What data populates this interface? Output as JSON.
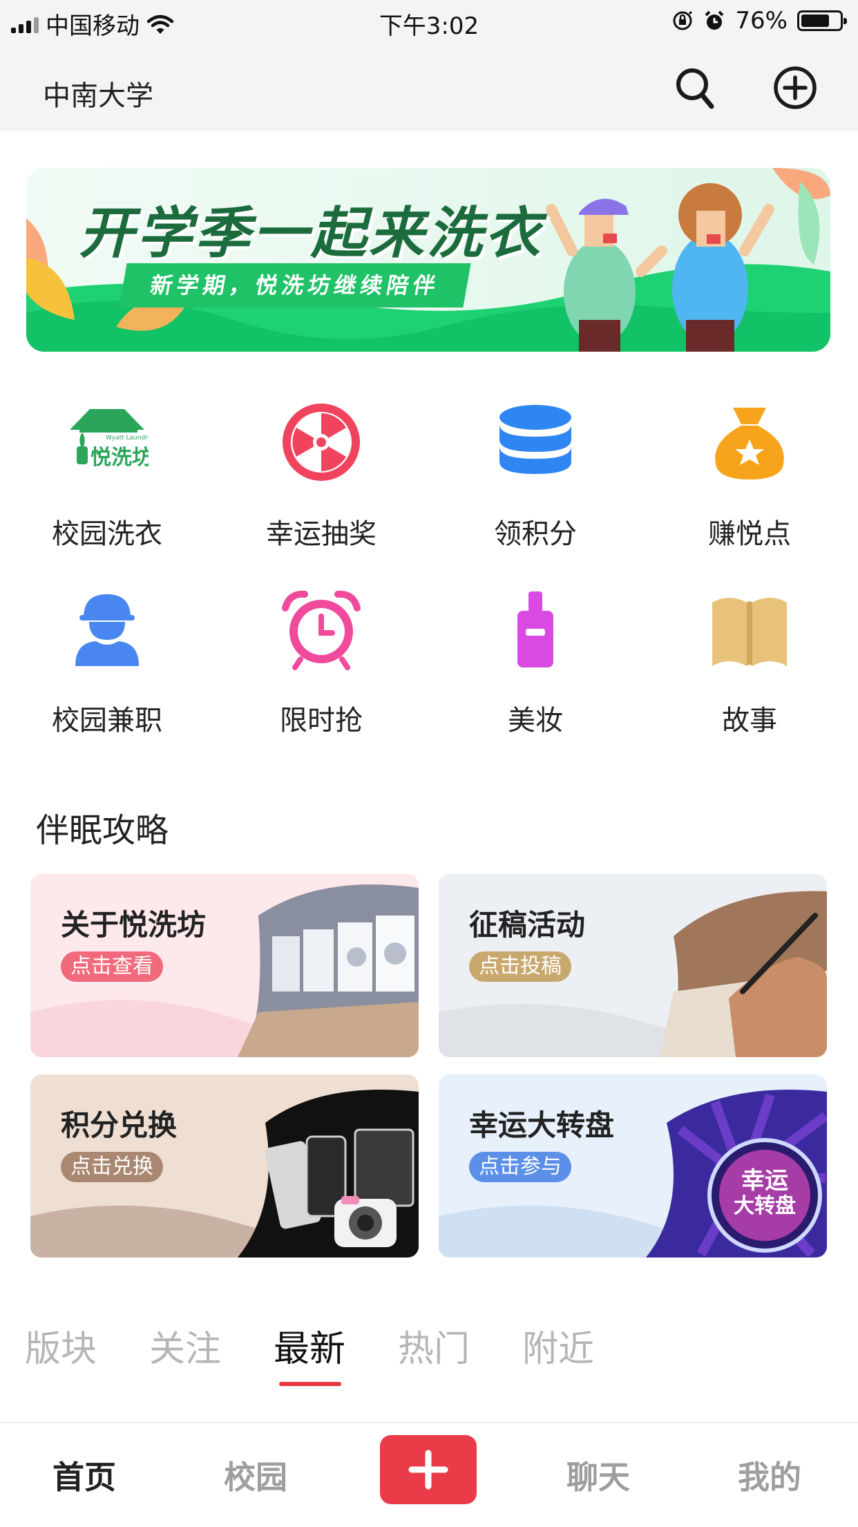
{
  "status_bar": {
    "carrier": "中国移动",
    "time": "下午3:02",
    "battery_percent": "76%",
    "battery_level": 0.76
  },
  "header": {
    "school_name": "中南大学",
    "search_icon": "search-icon",
    "add_icon": "add-circle-icon"
  },
  "banner": {
    "title": "开学季一起来洗衣",
    "subtitle": "新学期，悦洗坊继续陪伴",
    "logo_text": "悦洗坊",
    "logo_sub": "Wyatt Laundry"
  },
  "services": [
    {
      "label": "校园洗衣",
      "icon": "laundry-house-icon",
      "color": "#2aa55a"
    },
    {
      "label": "幸运抽奖",
      "icon": "lucky-wheel-icon",
      "color": "#f0445e"
    },
    {
      "label": "领积分",
      "icon": "coin-stack-icon",
      "color": "#2e86f0"
    },
    {
      "label": "赚悦点",
      "icon": "money-bag-icon",
      "color": "#f7a41c"
    },
    {
      "label": "校园兼职",
      "icon": "worker-icon",
      "color": "#4a86f0"
    },
    {
      "label": "限时抢",
      "icon": "alarm-clock-icon",
      "color": "#f04a9c"
    },
    {
      "label": "美妆",
      "icon": "cosmetic-bottle-icon",
      "color": "#d94ae0"
    },
    {
      "label": "故事",
      "icon": "book-icon",
      "color": "#e8c27a"
    }
  ],
  "guide": {
    "title": "伴眠攻略",
    "cards": [
      {
        "title": "关于悦洗坊",
        "button": "点击查看",
        "button_color": "#f06a7c",
        "bg": "#fde9ec"
      },
      {
        "title": "征稿活动",
        "button": "点击投稿",
        "button_color": "#c9a86e",
        "bg": "#eceff3"
      },
      {
        "title": "积分兑换",
        "button": "点击兑换",
        "button_color": "#a98770",
        "bg": "#efdfd3"
      },
      {
        "title": "幸运大转盘",
        "button": "点击参与",
        "button_color": "#5b8fe8",
        "bg": "#e7f0fb",
        "badge_line1": "幸运",
        "badge_line2": "大转盘"
      }
    ]
  },
  "feed_tabs": {
    "items": [
      "版块",
      "关注",
      "最新",
      "热门",
      "附近"
    ],
    "active": "最新"
  },
  "bottom_nav": {
    "items": [
      "首页",
      "校园",
      "聊天",
      "我的"
    ],
    "active": "首页",
    "center_icon": "plus-icon"
  }
}
